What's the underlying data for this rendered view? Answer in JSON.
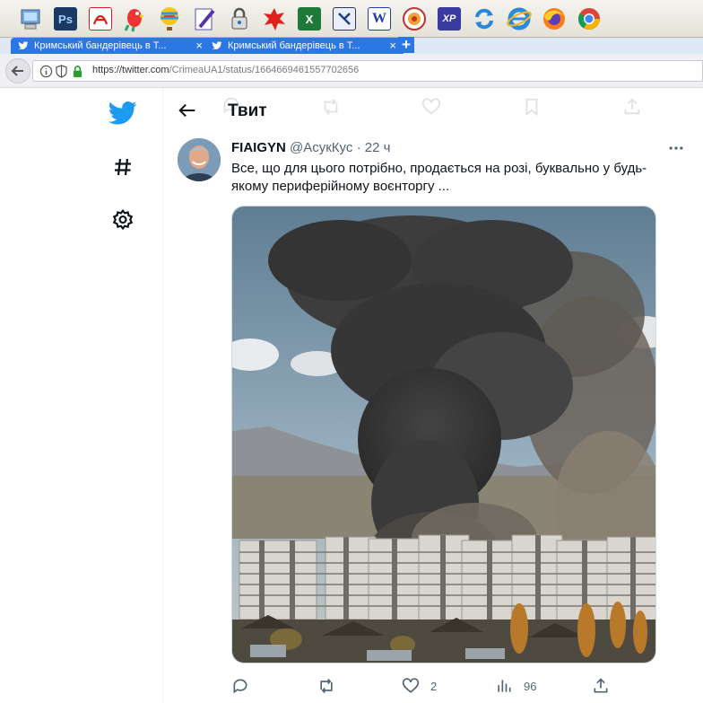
{
  "taskbar": {
    "apps": [
      {
        "icon": "my-computer-icon"
      },
      {
        "icon": "photoshop-icon",
        "label": "Ps"
      },
      {
        "icon": "acrobat-icon"
      },
      {
        "icon": "parrot-icon"
      },
      {
        "icon": "balloon-icon"
      },
      {
        "icon": "pen-document-icon"
      },
      {
        "icon": "lock-icon"
      },
      {
        "icon": "red-splat-icon"
      },
      {
        "icon": "excel-icon",
        "label": "X"
      },
      {
        "icon": "vector-document-icon"
      },
      {
        "icon": "word-icon",
        "label": "W"
      },
      {
        "icon": "circle-app-icon"
      },
      {
        "icon": "floppy-xp-icon",
        "label": "XP"
      },
      {
        "icon": "sync-icon"
      },
      {
        "icon": "internet-explorer-icon"
      },
      {
        "icon": "firefox-icon"
      },
      {
        "icon": "chrome-icon"
      }
    ]
  },
  "browser": {
    "tabs": [
      {
        "label": "Кримський бандерівець в Т...",
        "close": "×"
      },
      {
        "label": "Кримський бандерівець в Т...",
        "close": "×"
      }
    ],
    "new_tab": "+",
    "url_host": "https://twitter.com",
    "url_path": "/CrimeaUA1/status/1664669461557702656"
  },
  "twitter": {
    "page_title": "Твит",
    "tweet": {
      "author_name": "FIAIGYN",
      "author_handle": "@АсукКус",
      "separator": "·",
      "time": "22 ч",
      "text": "Все, що для цього потрібно, продається на розі, буквально у будь-якому периферійному воєнторгу ...",
      "likes": "2",
      "views": "96"
    }
  },
  "colors": {
    "twitter_blue": "#1d9bf0",
    "text": "#0f1419",
    "muted": "#536471",
    "tab_blue": "#2b77e4"
  }
}
